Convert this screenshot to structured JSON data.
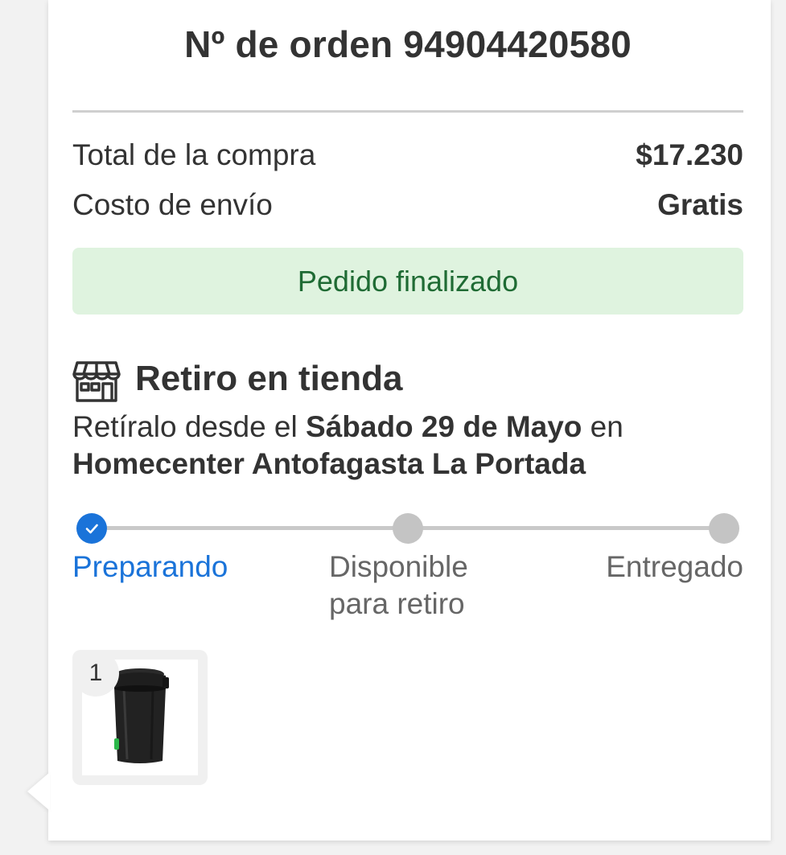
{
  "order": {
    "title": "Nº de orden 94904420580"
  },
  "summary": {
    "total_label": "Total de la compra",
    "total_value": "$17.230",
    "shipping_label": "Costo de envío",
    "shipping_value": "Gratis"
  },
  "status": {
    "text": "Pedido finalizado",
    "bg_color": "#dff3df",
    "text_color": "#1f6b34"
  },
  "pickup": {
    "icon": "store-icon",
    "title": "Retiro en tienda",
    "desc_prefix": "Retíralo desde el ",
    "date": "Sábado 29 de Mayo",
    "desc_mid": " en",
    "store": "Homecenter Antofagasta La Portada"
  },
  "progress": {
    "accent_color": "#1a73d9",
    "steps": [
      {
        "line1": "Preparando",
        "line2": "",
        "state": "done"
      },
      {
        "line1": "Disponible",
        "line2": "para retiro",
        "state": "pending"
      },
      {
        "line1": "Entregado",
        "line2": "",
        "state": "pending"
      }
    ]
  },
  "items": [
    {
      "quantity": "1",
      "image": "trash-bin-product"
    }
  ]
}
